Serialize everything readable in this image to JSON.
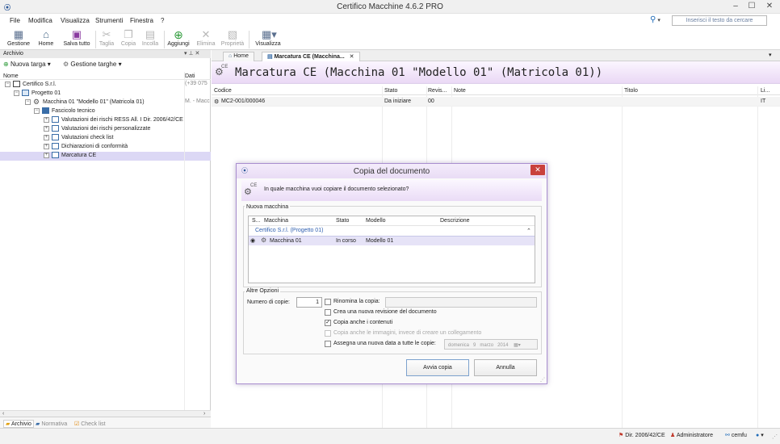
{
  "window": {
    "title": "Certifico Macchine 4.6.2 PRO",
    "minimize": "–",
    "maximize": "☐",
    "close": "✕"
  },
  "menu": [
    "File",
    "Modifica",
    "Visualizza",
    "Strumenti",
    "Finestra",
    "?"
  ],
  "search": {
    "placeholder": "Inserisci il testo da cercare",
    "dropdown": "▾"
  },
  "toolbar": {
    "gestione": "Gestione",
    "home": "Home",
    "salva_tutto": "Salva tutto",
    "taglia": "Taglia",
    "copia": "Copia",
    "incolla": "Incolla",
    "aggiungi": "Aggiungi",
    "elimina": "Elimina",
    "proprieta": "Proprietà",
    "visualizza": "Visualizza"
  },
  "archive_panel": {
    "title": "Archivio",
    "pin": "▾ ⊥ ✕",
    "new_target": "Nuova targa",
    "manage_targets": "Gestione targhe",
    "col_name": "Nome",
    "col_data": "Dati",
    "tree": [
      {
        "label": "Certifico S.r.l.",
        "data": "(+39 075",
        "indent": 0,
        "exp": "−"
      },
      {
        "label": "Progetto 01",
        "data": "",
        "indent": 1,
        "exp": "−"
      },
      {
        "label": "Macchina 01 \"Modello 01\" (Matricola 01)",
        "data": "M. - Macc",
        "indent": 2,
        "exp": "−"
      },
      {
        "label": "Fascicolo tecnico",
        "data": "",
        "indent": 3,
        "exp": "−"
      },
      {
        "label": "Valutazioni dei rischi RESS All. I Dir. 2006/42/CE",
        "data": "",
        "indent": 4,
        "exp": "+"
      },
      {
        "label": "Valutazioni dei rischi personalizzate",
        "data": "",
        "indent": 4,
        "exp": "+"
      },
      {
        "label": "Valutazioni check list",
        "data": "",
        "indent": 4,
        "exp": "+"
      },
      {
        "label": "Dichiarazioni di conformità",
        "data": "",
        "indent": 4,
        "exp": "+"
      },
      {
        "label": "Marcatura CE",
        "data": "",
        "indent": 4,
        "exp": "+"
      }
    ],
    "bottom_tabs": [
      "Archivio",
      "Normativa",
      "Check list"
    ]
  },
  "doc_tabs": {
    "home": "Home",
    "active": "Marcatura CE (Macchina...",
    "overflow": "▾"
  },
  "document": {
    "title": "Marcatura CE (Macchina 01 \"Modello 01\" (Matricola 01))",
    "columns": [
      "Codice",
      "Stato",
      "Revis...",
      "Note",
      "Titolo",
      "Li..."
    ],
    "rows": [
      {
        "codice": "MC2-001/000046",
        "stato": "Da iniziare",
        "revisione": "00",
        "note": "",
        "titolo": "",
        "lingua": "IT"
      }
    ]
  },
  "dialog": {
    "title": "Copia del documento",
    "close": "✕",
    "question": "In quale macchina vuoi copiare il documento selezionato?",
    "new_machine_group": "Nuova macchina",
    "list_columns": [
      "S...",
      "Macchina",
      "Stato",
      "Modello",
      "Descrizione"
    ],
    "list_group": "Certifico S.r.l. (Progetto 01)",
    "list_rows": [
      {
        "machine": "Macchina 01",
        "state": "In corso",
        "model": "Modello 01",
        "description": "",
        "selected": true
      }
    ],
    "other_options_group": "Altre Opzioni",
    "copies_label": "Numero di copie:",
    "copies_value": "1",
    "rename_label": "Rinomina la copia:",
    "rename_value": "",
    "new_revision_label": "Crea una nuova revisione del documento",
    "copy_contents_label": "Copia anche i contenuti",
    "copy_images_label": "Copia anche le immagini, invece di creare un collegamento",
    "new_date_label": "Assegna una nuova data a tutte le copie:",
    "date_day": "domenica",
    "date_num": "9",
    "date_month": "marzo",
    "date_year": "2014",
    "start_button": "Avvia copia",
    "cancel_button": "Annulla",
    "options": {
      "rename": false,
      "new_revision": false,
      "copy_contents": true,
      "copy_images": false,
      "new_date": false
    }
  },
  "statusbar": {
    "directive": "Dir. 2006/42/CE",
    "user": "Administratore",
    "account": "cemfu",
    "help": "▾"
  },
  "colors": {
    "accent": "#1e6bb8",
    "header_purple": "#ead8f5",
    "dialog_close": "#c9413c",
    "selected_row": "#dcd8f5"
  }
}
